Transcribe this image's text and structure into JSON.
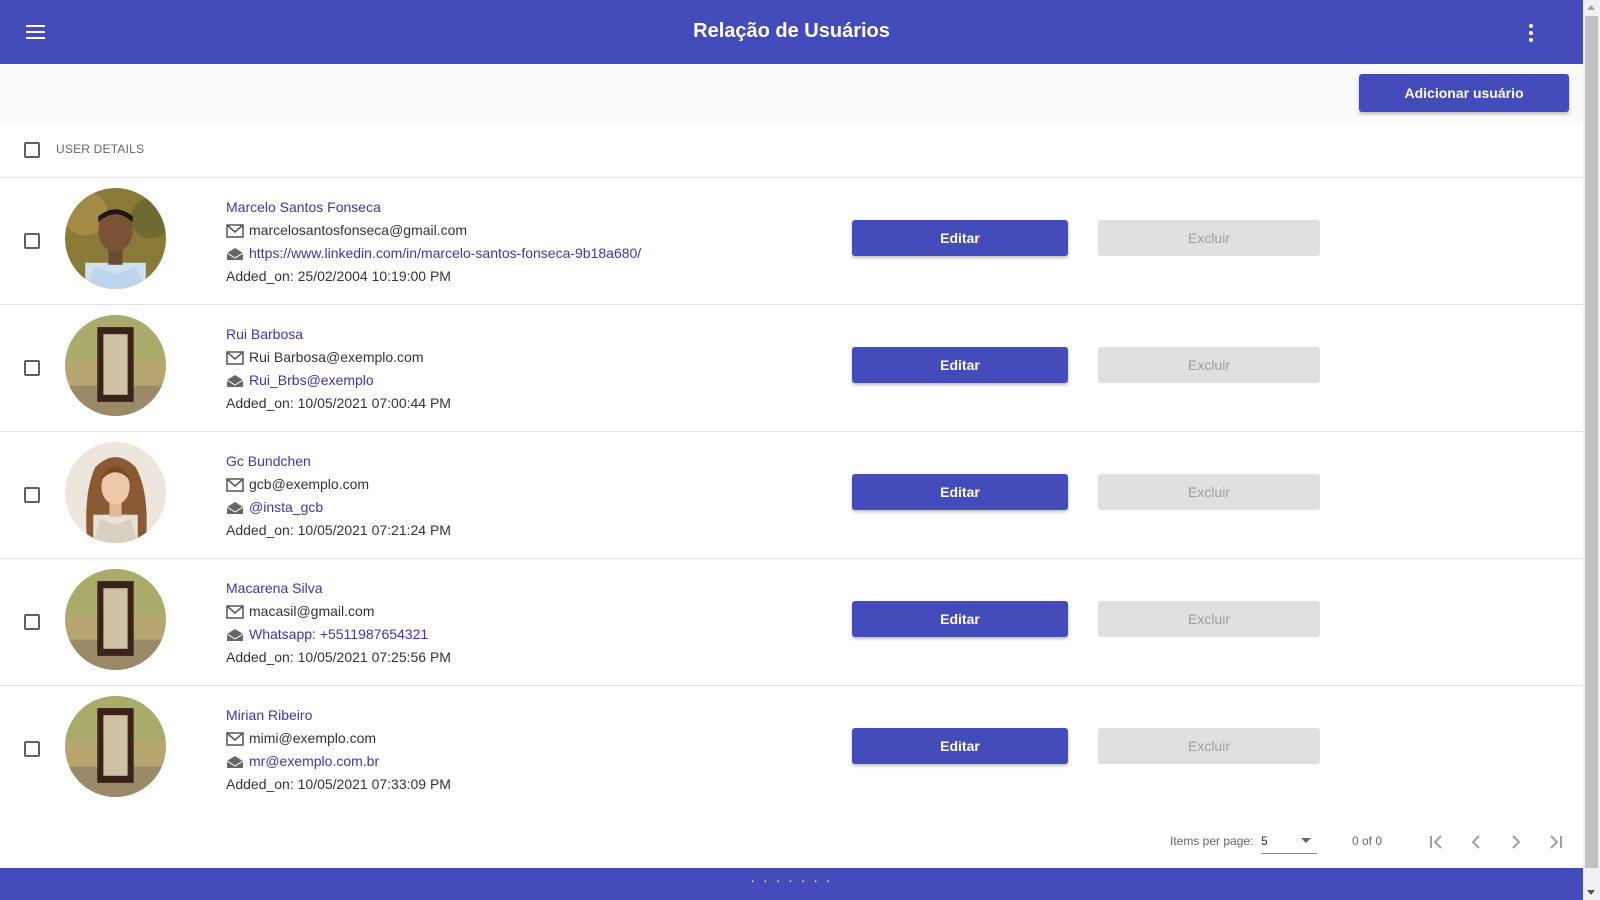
{
  "header": {
    "title": "Relação de Usuários",
    "menu_icon": "menu-icon",
    "more_icon": "more-vert-icon"
  },
  "actions": {
    "add_user_label": "Adicionar usuário"
  },
  "table": {
    "header_label": "USER DETAILS",
    "edit_label": "Editar",
    "delete_label": "Excluir",
    "rows": [
      {
        "name": "Marcelo Santos Fonseca",
        "email": "marcelosantosfonseca@gmail.com",
        "contact": "https://www.linkedin.com/in/marcelo-santos-fonseca-9b18a680/",
        "added": "Added_on: 25/02/2004 10:19:00 PM",
        "avatar": "photo-man"
      },
      {
        "name": "Rui Barbosa",
        "email": "Rui Barbosa@exemplo.com",
        "contact": "Rui_Brbs@exemplo",
        "added": "Added_on: 10/05/2021 07:00:44 PM",
        "avatar": "placeholder-frame"
      },
      {
        "name": "Gc Bundchen",
        "email": "gcb@exemplo.com",
        "contact": "@insta_gcb",
        "added": "Added_on: 10/05/2021 07:21:24 PM",
        "avatar": "photo-woman"
      },
      {
        "name": "Macarena Silva",
        "email": "macasil@gmail.com",
        "contact": "Whatsapp: +5511987654321",
        "added": "Added_on: 10/05/2021 07:25:56 PM",
        "avatar": "placeholder-frame"
      },
      {
        "name": "Mirian Ribeiro",
        "email": "mimi@exemplo.com",
        "contact": "mr@exemplo.com.br",
        "added": "Added_on: 10/05/2021 07:33:09 PM",
        "avatar": "placeholder-frame"
      }
    ]
  },
  "paginator": {
    "items_per_page_label": "Items per page:",
    "items_per_page_value": "5",
    "range_label": "0 of 0"
  },
  "footer": {
    "handle": "· · · · · · ·"
  },
  "colors": {
    "primary": "#444bba",
    "link": "#3c34b5",
    "disabled_bg": "#e0e0e0",
    "disabled_text": "#9e9e9e"
  }
}
